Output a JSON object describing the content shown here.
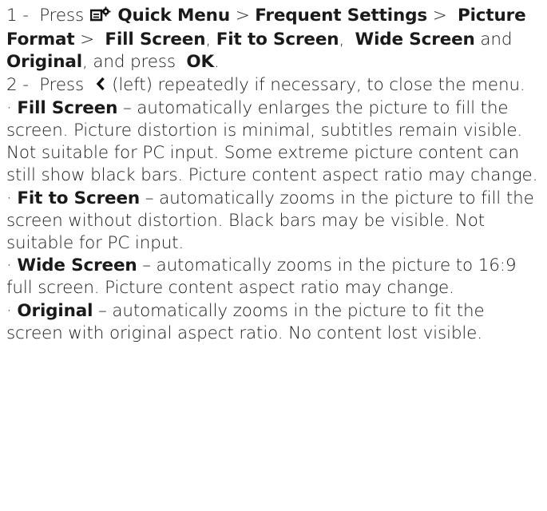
{
  "steps": [
    {
      "number": "1 -",
      "press": "Press",
      "quick_menu": "Quick Menu",
      "sep1": ">",
      "frequent_settings": "Frequent Settings",
      "sep2": ">",
      "picture_format": "Picture Format",
      "sep3": ">",
      "fill_screen": "Fill Screen",
      "comma1": ",",
      "fit_to_screen": "Fit to Screen",
      "comma2": ",",
      "wide_screen": "Wide Screen",
      "and": "and",
      "original": "Original",
      "and_press": ", and press",
      "ok": "OK",
      "period": "."
    },
    {
      "number": "2 -",
      "press": "Press",
      "rest": "(left) repeatedly if necessary, to close the menu."
    }
  ],
  "bullets": [
    {
      "term": "Fill Screen",
      "text": "– automatically enlarges the picture to fill the screen. Picture distortion is minimal, subtitles remain visible. Not suitable for PC input. Some extreme picture content can still show black bars. Picture content aspect ratio may change."
    },
    {
      "term": "Fit to Screen",
      "text": "– automatically zooms in the picture to fill the screen without distortion. Black bars may be visible. Not suitable for PC input."
    },
    {
      "term": "Wide Screen",
      "text": "– automatically zooms in the picture to 16:9 full screen. Picture content aspect ratio may change."
    },
    {
      "term": "Original",
      "text": "– automatically zooms in the picture to fit the screen with original aspect ratio. No content lost visible."
    }
  ],
  "bullet_marker": "·",
  "icons": {
    "quick_menu": "quick-menu-icon",
    "left": "chevron-left-icon"
  }
}
